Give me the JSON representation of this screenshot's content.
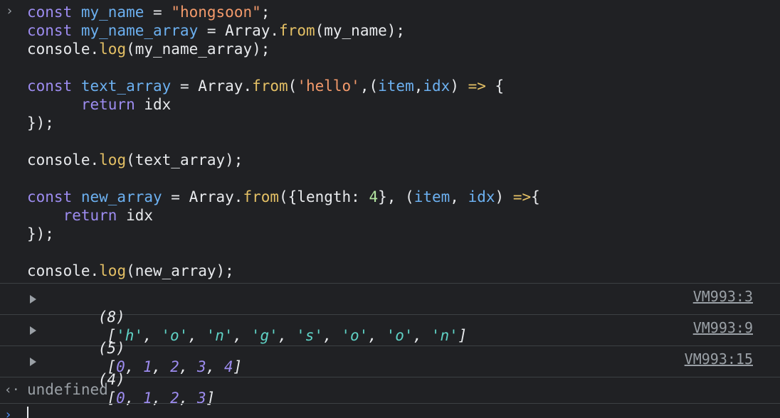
{
  "input": {
    "lines": [
      [
        [
          "kw",
          "const "
        ],
        [
          "var",
          "my_name"
        ],
        [
          "plain",
          " = "
        ],
        [
          "str",
          "\"hongsoon\""
        ],
        [
          "plain",
          ";"
        ]
      ],
      [
        [
          "kw",
          "const "
        ],
        [
          "var",
          "my_name_array"
        ],
        [
          "plain",
          " = Array."
        ],
        [
          "fn",
          "from"
        ],
        [
          "plain",
          "(my_name);"
        ]
      ],
      [
        [
          "plain",
          "console."
        ],
        [
          "fn",
          "log"
        ],
        [
          "plain",
          "(my_name_array);"
        ]
      ],
      [],
      [
        [
          "kw",
          "const "
        ],
        [
          "var",
          "text_array"
        ],
        [
          "plain",
          " = Array."
        ],
        [
          "fn",
          "from"
        ],
        [
          "plain",
          "("
        ],
        [
          "str",
          "'hello'"
        ],
        [
          "plain",
          ",("
        ],
        [
          "var",
          "item"
        ],
        [
          "plain",
          ","
        ],
        [
          "var",
          "idx"
        ],
        [
          "plain",
          ") "
        ],
        [
          "fn",
          "=>"
        ],
        [
          "plain",
          " {"
        ]
      ],
      [
        [
          "plain",
          "      "
        ],
        [
          "kw",
          "return"
        ],
        [
          "plain",
          " idx"
        ]
      ],
      [
        [
          "plain",
          "});"
        ]
      ],
      [],
      [
        [
          "plain",
          "console."
        ],
        [
          "fn",
          "log"
        ],
        [
          "plain",
          "(text_array);"
        ]
      ],
      [],
      [
        [
          "kw",
          "const "
        ],
        [
          "var",
          "new_array"
        ],
        [
          "plain",
          " = Array."
        ],
        [
          "fn",
          "from"
        ],
        [
          "plain",
          "({length: "
        ],
        [
          "num",
          "4"
        ],
        [
          "plain",
          "}, ("
        ],
        [
          "var",
          "item"
        ],
        [
          "plain",
          ", "
        ],
        [
          "var",
          "idx"
        ],
        [
          "plain",
          ") "
        ],
        [
          "fn",
          "=>"
        ],
        [
          "plain",
          "{"
        ]
      ],
      [
        [
          "plain",
          "    "
        ],
        [
          "kw",
          "return"
        ],
        [
          "plain",
          " idx"
        ]
      ],
      [
        [
          "plain",
          "});"
        ]
      ],
      [],
      [
        [
          "plain",
          "console."
        ],
        [
          "fn",
          "log"
        ],
        [
          "plain",
          "(new_array);"
        ]
      ]
    ]
  },
  "outputs": [
    {
      "count": "(8)",
      "items": [
        "'h'",
        "'o'",
        "'n'",
        "'g'",
        "'s'",
        "'o'",
        "'o'",
        "'n'"
      ],
      "item_type": "str",
      "source": "VM993:3"
    },
    {
      "count": "(5)",
      "items": [
        "0",
        "1",
        "2",
        "3",
        "4"
      ],
      "item_type": "num",
      "source": "VM993:9"
    },
    {
      "count": "(4)",
      "items": [
        "0",
        "1",
        "2",
        "3"
      ],
      "item_type": "num",
      "source": "VM993:15"
    }
  ],
  "return_value": "undefined",
  "icons": {
    "input_prompt": "›",
    "return_arrow": "‹·",
    "active_prompt": "›"
  },
  "colors": {
    "background": "#202124",
    "keyword": "#9d8cf0",
    "variable": "#6cb0f0",
    "function": "#e4c065",
    "string": "#f39a6b",
    "number": "#b3e5a0",
    "array_string": "#5fd3c6",
    "array_number": "#9d8cf0",
    "muted": "#9aa0a6",
    "prompt_accent": "#4d8ef7"
  }
}
